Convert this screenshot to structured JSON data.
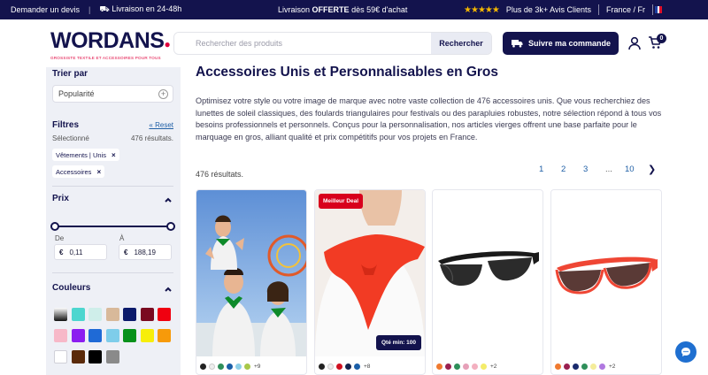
{
  "topbar": {
    "quote": "Demander un devis",
    "delivery": "Livraison en 24-48h",
    "offer_prefix": "Livraison",
    "offer_bold": "OFFERTE",
    "offer_suffix": "dès 59€ d'achat",
    "stars": "★★★★★",
    "reviews": "Plus de 3k+ Avis Clients",
    "locale": "France / Fr"
  },
  "header": {
    "logo": "WORDANS",
    "logo_tagline": "GROSSISTE TEXTILE ET ACCESSOIRES POUR TOUS",
    "search_placeholder": "Rechercher des produits",
    "search_button": "Rechercher",
    "track_button": "Suivre ma commande",
    "cart_count": "0"
  },
  "sidebar": {
    "sort_title": "Trier par",
    "sort_value": "Popularité",
    "filters_title": "Filtres",
    "reset": "« Reset",
    "selected_label": "Sélectionné",
    "selected_count": "476 résultats.",
    "chips": [
      {
        "label": "Vêtements | Unis",
        "remove": "×"
      },
      {
        "label": "Accessoires",
        "remove": "×"
      }
    ],
    "price_title": "Prix",
    "price_from_label": "De",
    "price_to_label": "À",
    "currency": "€",
    "price_min": "0,11",
    "price_max": "188,19",
    "colors_title": "Couleurs",
    "colors": [
      "#1f1f1f",
      "#4dd6cf",
      "#cfeeea",
      "#d8b99a",
      "#0b1a6b",
      "#7a0a20",
      "#f00010",
      "#f7b8c8",
      "#8b1df0",
      "#1f6ad6",
      "#7ecdea",
      "#07911a",
      "#f7ee0a",
      "#f79a0a",
      "#ffffff",
      "#5a2a0a",
      "#000000",
      "#8a8a8a"
    ]
  },
  "main": {
    "title": "Accessoires Unis et Personnalisables en Gros",
    "description": "Optimisez votre style ou votre image de marque avec notre vaste collection de 476 accessoires unis. Que vous recherchiez des lunettes de soleil classiques, des foulards triangulaires pour festivals ou des parapluies robustes, notre sélection répond à tous vos besoins professionnels et personnels. Conçus pour la personnalisation, nos articles vierges offrent une base parfaite pour le marquage en gros, alliant qualité et prix compétitifs pour vos projets en France.",
    "results": "476 résultats.",
    "pages": [
      "1",
      "2",
      "3",
      "...",
      "10"
    ],
    "next": "❯"
  },
  "products": [
    {
      "colors": [
        "#222222",
        "#eeeeee",
        "#2f8f5a",
        "#1b5fa8",
        "#8fd0e8",
        "#a8c84a"
      ],
      "more": "+9"
    },
    {
      "badge": "Meilleur Deal",
      "qty": "Qté min: 100",
      "colors": [
        "#222222",
        "#eeeeee",
        "#d01020",
        "#13234d",
        "#1b5fa8"
      ],
      "more": "+8"
    },
    {
      "colors": [
        "#f07a30",
        "#9a2050",
        "#2f8f5a",
        "#e6a0b8",
        "#f3b0c0",
        "#f4ec6a"
      ],
      "more": "+2"
    },
    {
      "colors": [
        "#f07a30",
        "#9a2050",
        "#1a2a6d",
        "#2f8f5a",
        "#f4ec9a",
        "#b078e0"
      ],
      "more": "+2"
    }
  ]
}
